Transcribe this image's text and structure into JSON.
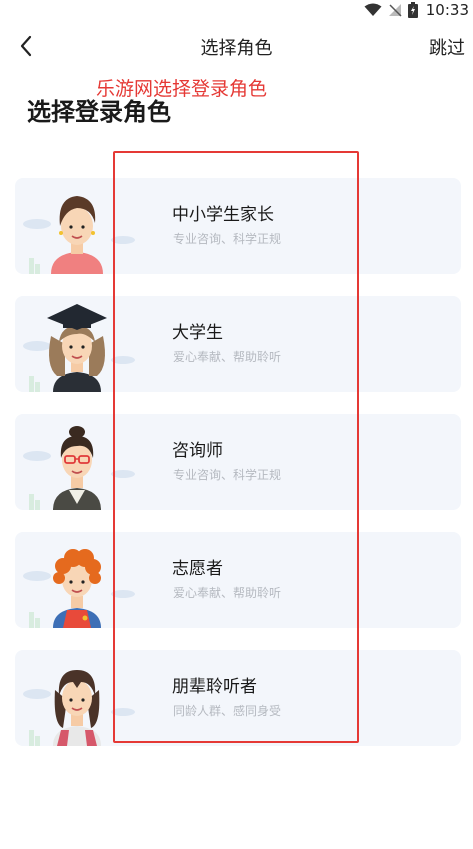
{
  "status": {
    "time": "10:33"
  },
  "nav": {
    "title": "选择角色",
    "skip_label": "跳过"
  },
  "watermark": "乐游网选择登录角色",
  "heading": "选择登录角色",
  "roles": [
    {
      "title": "中小学生家长",
      "desc": "专业咨询、科学正规",
      "avatar": "parent-avatar"
    },
    {
      "title": "大学生",
      "desc": "爱心奉献、帮助聆听",
      "avatar": "graduate-avatar"
    },
    {
      "title": "咨询师",
      "desc": "专业咨询、科学正规",
      "avatar": "counselor-avatar"
    },
    {
      "title": "志愿者",
      "desc": "爱心奉献、帮助聆听",
      "avatar": "volunteer-avatar"
    },
    {
      "title": "朋辈聆听者",
      "desc": "同龄人群、感同身受",
      "avatar": "peer-listener-avatar"
    }
  ],
  "colors": {
    "highlight": "#e53935",
    "card_bg": "#f3f6fb",
    "desc_text": "#b5b9c0"
  }
}
